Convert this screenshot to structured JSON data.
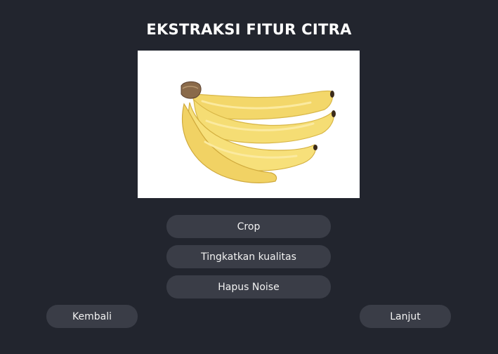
{
  "page": {
    "title": "EKSTRAKSI FITUR CITRA"
  },
  "image": {
    "subject": "bananas"
  },
  "actions": {
    "crop_label": "Crop",
    "enhance_label": "Tingkatkan kualitas",
    "denoise_label": "Hapus Noise"
  },
  "nav": {
    "back_label": "Kembali",
    "next_label": "Lanjut"
  },
  "colors": {
    "background": "#22252e",
    "button": "#3a3d47",
    "text": "#ffffff",
    "banana": "#f4d35e"
  }
}
